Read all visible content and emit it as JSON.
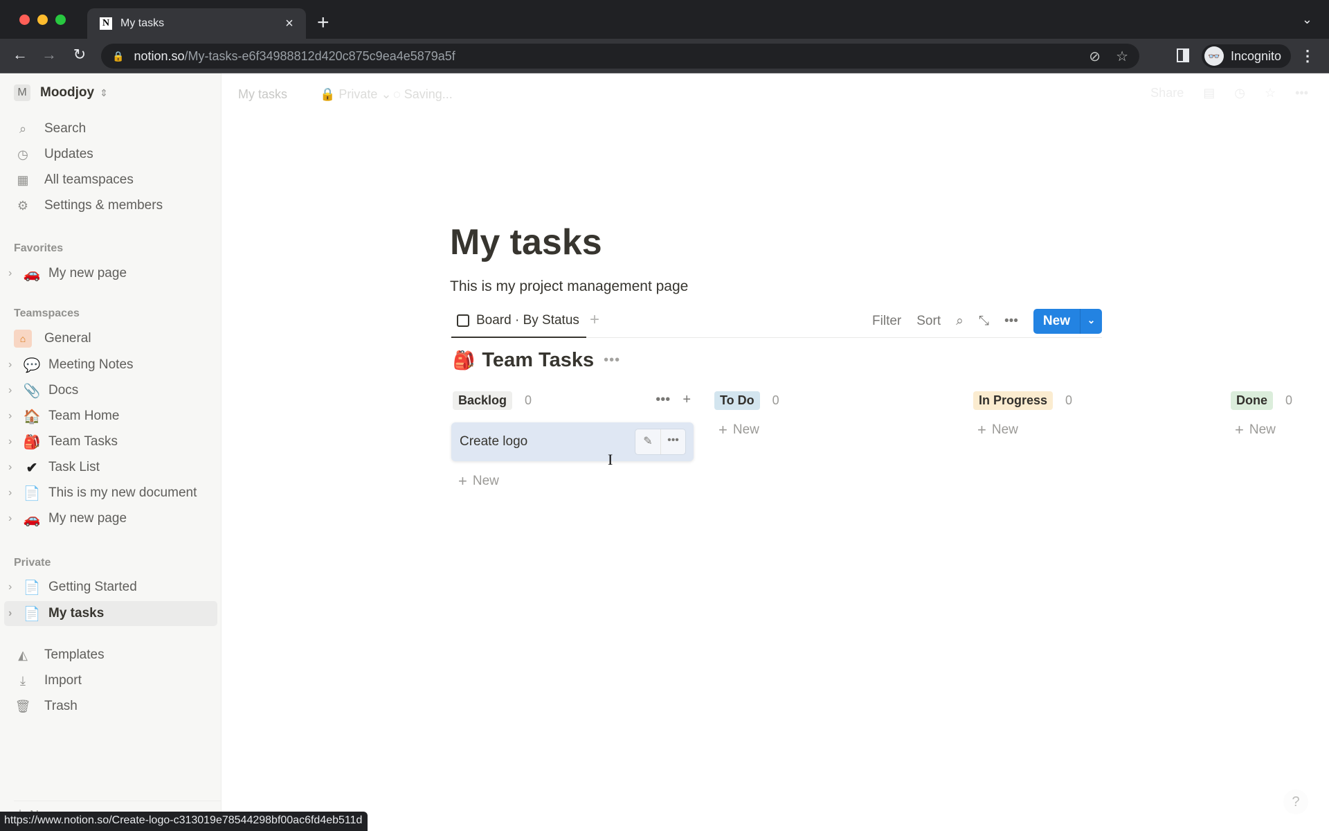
{
  "browser": {
    "tab_title": "My tasks",
    "tab_favicon": "N",
    "new_tab": "+",
    "url_host": "notion.so",
    "url_path": "/My-tasks-e6f34988812d420c875c9ea4e5879a5f",
    "profile_label": "Incognito",
    "status_url": "https://www.notion.so/Create-logo-c313019e78544298bf00ac6fd4eb511d"
  },
  "workspace": {
    "initial": "M",
    "name": "Moodjoy"
  },
  "sidebar": {
    "top_items": [
      {
        "label": "Search",
        "icon": "search-icon"
      },
      {
        "label": "Updates",
        "icon": "clock-icon"
      },
      {
        "label": "All teamspaces",
        "icon": "building-icon"
      },
      {
        "label": "Settings & members",
        "icon": "gear-icon"
      }
    ],
    "favorites_label": "Favorites",
    "favorites": [
      {
        "label": "My new page",
        "emoji": "🚗"
      }
    ],
    "teamspaces_label": "Teamspaces",
    "teamspace_general": "General",
    "teamspace_pages": [
      {
        "label": "Meeting Notes",
        "emoji": "💬"
      },
      {
        "label": "Docs",
        "emoji": "📎"
      },
      {
        "label": "Team Home",
        "emoji": "🏠"
      },
      {
        "label": "Team Tasks",
        "emoji": "🎒"
      },
      {
        "label": "Task List",
        "emoji": "✔"
      },
      {
        "label": "This is my new document",
        "emoji": "📄"
      },
      {
        "label": "My new page",
        "emoji": "🚗"
      }
    ],
    "private_label": "Private",
    "private_pages": [
      {
        "label": "Getting Started",
        "emoji": "📄"
      },
      {
        "label": "My tasks",
        "emoji": "📄"
      }
    ],
    "bottom_items": [
      {
        "label": "Templates",
        "icon": "templates-icon"
      },
      {
        "label": "Import",
        "icon": "import-icon"
      },
      {
        "label": "Trash",
        "icon": "trash-icon"
      }
    ],
    "new_page": "New page"
  },
  "topbar": {
    "breadcrumb": "My tasks",
    "privacy": "Private",
    "saving": "Saving...",
    "share": "Share"
  },
  "page": {
    "title": "My tasks",
    "description": "This is my project management page",
    "view_tab": "Board · By Status",
    "tools": {
      "filter": "Filter",
      "sort": "Sort",
      "new": "New"
    },
    "database": {
      "emoji": "🎒",
      "name": "Team Tasks"
    },
    "columns": [
      {
        "label": "Backlog",
        "count": "0",
        "color": "#efefed",
        "cards": [
          "Create logo"
        ],
        "new": "New"
      },
      {
        "label": "To Do",
        "count": "0",
        "color": "#d3e5ef",
        "cards": [],
        "new": "New"
      },
      {
        "label": "In Progress",
        "count": "0",
        "color": "#fbecd0",
        "cards": [],
        "new": "New"
      },
      {
        "label": "Done",
        "count": "0",
        "color": "#dbeddb",
        "cards": [],
        "new": "New"
      }
    ]
  },
  "help": "?"
}
